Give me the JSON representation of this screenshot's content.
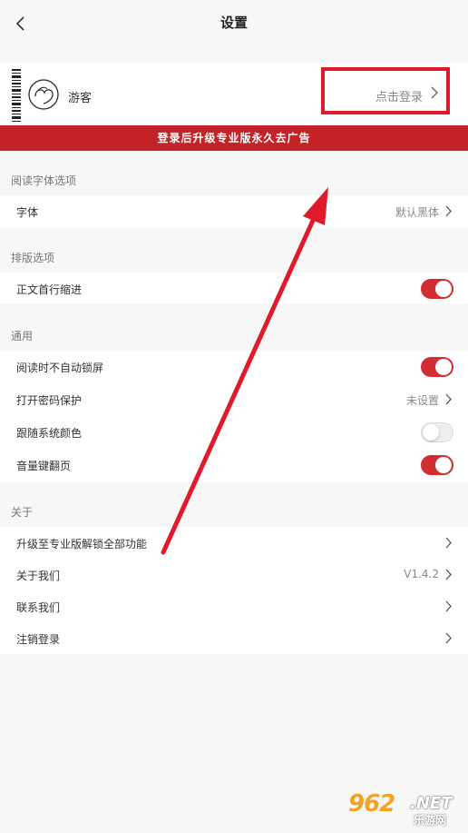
{
  "header": {
    "title": "设置"
  },
  "profile": {
    "nickname": "游客",
    "login_text": "点击登录"
  },
  "banner": {
    "text": "登录后升级专业版永久去广告"
  },
  "sections": [
    {
      "label": "阅读字体选项",
      "items": [
        {
          "label": "字体",
          "value": "默认黑体"
        }
      ]
    },
    {
      "label": "排版选项",
      "items": [
        {
          "label": "正文首行缩进",
          "toggle": true
        }
      ]
    },
    {
      "label": "通用",
      "items": [
        {
          "label": "阅读时不自动锁屏",
          "toggle": true
        },
        {
          "label": "打开密码保护",
          "value": "未设置"
        },
        {
          "label": "跟随系统颜色",
          "toggle": false
        },
        {
          "label": "音量键翻页",
          "toggle": true
        }
      ]
    },
    {
      "label": "关于",
      "items": [
        {
          "label": "升级至专业版解锁全部功能"
        },
        {
          "label": "关于我们",
          "value": "V1.4.2"
        },
        {
          "label": "联系我们"
        },
        {
          "label": "注销登录"
        }
      ]
    }
  ],
  "watermark": {
    "number": "962",
    "domain": ".NET",
    "cn": "乐游网"
  },
  "colors": {
    "accent": "#c42328",
    "highlight_box": "#e01a2b",
    "annotation_arrow": "#e01a2b"
  }
}
